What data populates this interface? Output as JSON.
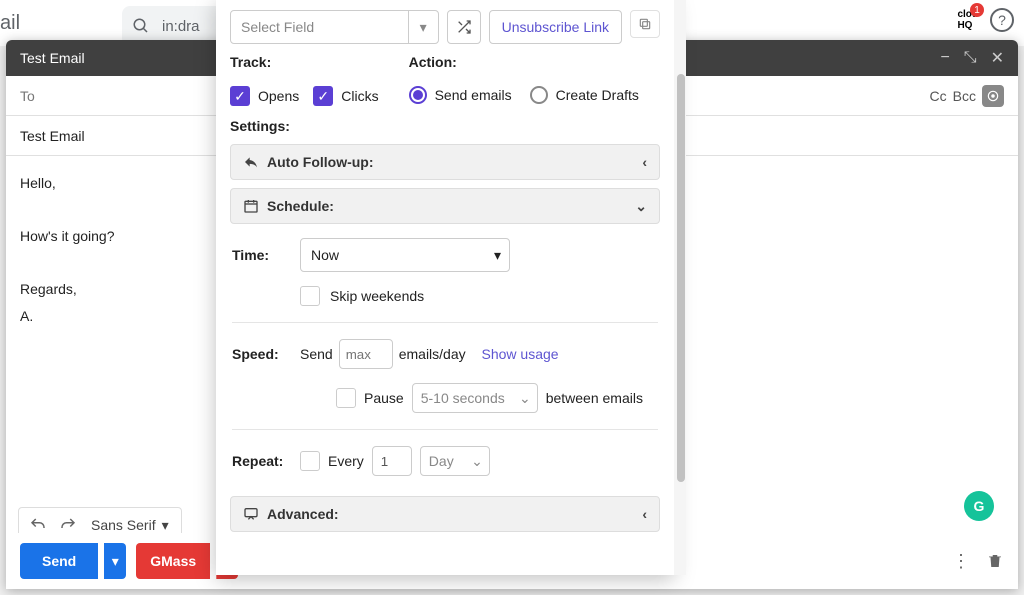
{
  "bg": {
    "gmail_fragment": "ail",
    "search_query": "in:dra",
    "cloudhq_label": "clou",
    "cloudhq_sub": "HQ",
    "cloudhq_count": "1"
  },
  "compose": {
    "title": "Test Email",
    "to_label": "To",
    "cc_label": "Cc",
    "bcc_label": "Bcc",
    "subject": "Test Email",
    "body_line1": "Hello,",
    "body_line2": "How's it going?",
    "body_line3": "Regards,",
    "body_line4": "A.",
    "font": "Sans Serif",
    "send_label": "Send",
    "gmass_label": "GMass"
  },
  "popover": {
    "select_field_placeholder": "Select Field",
    "unsubscribe_label": "Unsubscribe Link",
    "track_label": "Track:",
    "opens_label": "Opens",
    "clicks_label": "Clicks",
    "action_label": "Action:",
    "send_emails_label": "Send emails",
    "create_drafts_label": "Create Drafts",
    "settings_label": "Settings:",
    "auto_followup_label": "Auto Follow-up:",
    "schedule_label": "Schedule:",
    "time_label": "Time:",
    "time_value": "Now",
    "skip_weekends_label": "Skip weekends",
    "speed_label": "Speed:",
    "send_prefix": "Send",
    "speed_placeholder": "max",
    "speed_suffix": "emails/day",
    "show_usage": "Show usage",
    "pause_label": "Pause",
    "pause_value": "5-10 seconds",
    "between_emails": "between emails",
    "repeat_label": "Repeat:",
    "every_label": "Every",
    "repeat_count": "1",
    "repeat_unit": "Day",
    "advanced_label": "Advanced:"
  }
}
